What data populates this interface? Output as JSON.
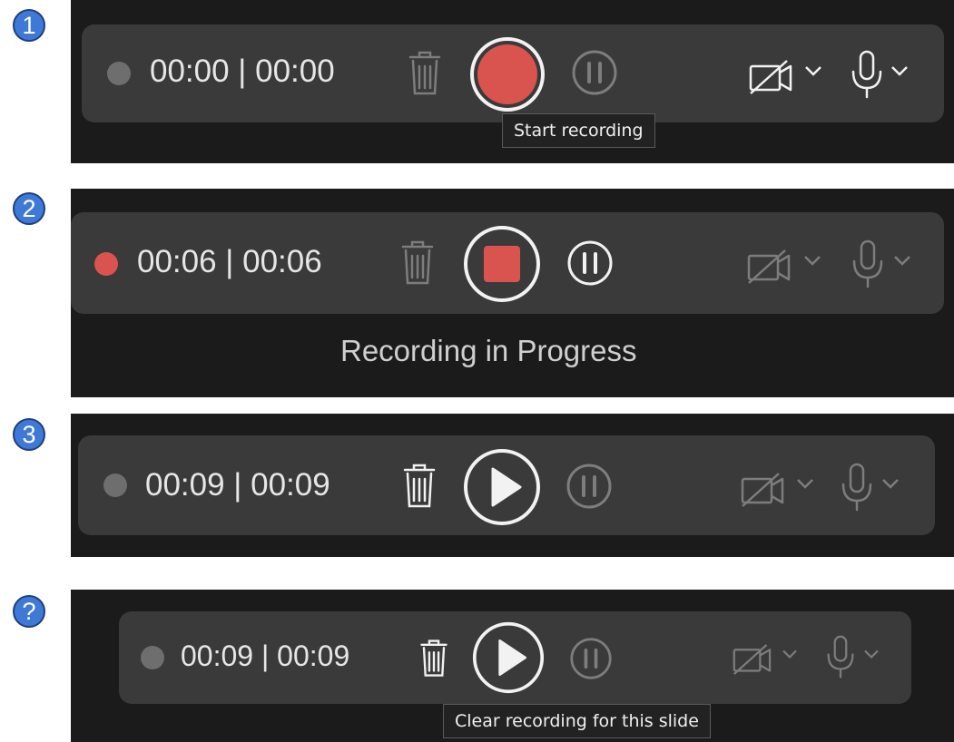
{
  "colors": {
    "record_red": "#d9534f",
    "bar_gray": "#3a3a3a",
    "panel_dark": "#1b1b1b",
    "badge_blue": "#3f79d8",
    "icon_active": "#f2f2f2",
    "icon_dim": "#7d7d7d"
  },
  "steps": [
    {
      "badge": "1",
      "indicator_state": "idle",
      "time": "00:00 | 00:00",
      "main_button": "record",
      "icons": [
        "trash-icon",
        "record-button",
        "pause-icon",
        "camera-off-icon",
        "chevron-down-icon",
        "microphone-icon",
        "chevron-down-icon"
      ],
      "tooltip": "Start recording"
    },
    {
      "badge": "2",
      "indicator_state": "recording",
      "time": "00:06 | 00:06",
      "main_button": "stop",
      "icons": [
        "trash-icon",
        "stop-button",
        "pause-icon",
        "camera-off-icon",
        "chevron-down-icon",
        "microphone-icon",
        "chevron-down-icon"
      ],
      "status": "Recording in Progress"
    },
    {
      "badge": "3",
      "indicator_state": "idle",
      "time": "00:09 | 00:09",
      "main_button": "play",
      "icons": [
        "trash-icon",
        "play-button",
        "pause-icon",
        "camera-off-icon",
        "chevron-down-icon",
        "microphone-icon",
        "chevron-down-icon"
      ]
    },
    {
      "badge": "?",
      "indicator_state": "idle",
      "time": "00:09 | 00:09",
      "main_button": "play",
      "icons": [
        "trash-icon",
        "play-button",
        "pause-icon",
        "camera-off-icon",
        "chevron-down-icon",
        "microphone-icon",
        "chevron-down-icon"
      ],
      "tooltip": "Clear recording for this slide"
    }
  ]
}
